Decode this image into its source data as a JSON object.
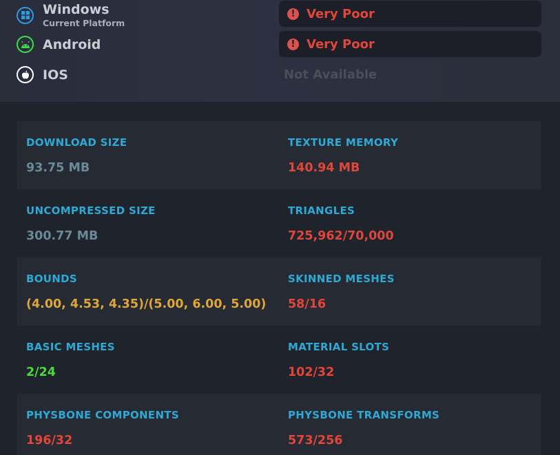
{
  "platforms": [
    {
      "name": "Windows",
      "sub": "Current Platform",
      "icon": "windows-icon",
      "color": "#2f9ae0",
      "rating": "Very Poor"
    },
    {
      "name": "Android",
      "icon": "android-icon",
      "color": "#3ddc4a",
      "rating": "Very Poor"
    },
    {
      "name": "IOS",
      "icon": "apple-icon",
      "color": "#ffffff",
      "rating": "Not Available"
    }
  ],
  "colors": {
    "label": "#2fa9d4",
    "neutral": "#6a8a97",
    "bad": "#e2463a",
    "warn": "#e0a63a",
    "good": "#4cd93a"
  },
  "stats": [
    {
      "label": "DOWNLOAD SIZE",
      "value": "93.75 MB",
      "status": "neutral"
    },
    {
      "label": "TEXTURE MEMORY",
      "value": "140.94 MB",
      "status": "bad"
    },
    {
      "label": "UNCOMPRESSED SIZE",
      "value": "300.77 MB",
      "status": "neutral"
    },
    {
      "label": "TRIANGLES",
      "value": "725,962/70,000",
      "status": "bad"
    },
    {
      "label": "BOUNDS",
      "value": "(4.00, 4.53, 4.35)/(5.00, 6.00, 5.00)",
      "status": "warn"
    },
    {
      "label": "SKINNED MESHES",
      "value": "58/16",
      "status": "bad"
    },
    {
      "label": "BASIC MESHES",
      "value": "2/24",
      "status": "good"
    },
    {
      "label": "MATERIAL SLOTS",
      "value": "102/32",
      "status": "bad"
    },
    {
      "label": "PHYSBONE COMPONENTS",
      "value": "196/32",
      "status": "bad"
    },
    {
      "label": "PHYSBONE TRANSFORMS",
      "value": "573/256",
      "status": "bad"
    }
  ]
}
